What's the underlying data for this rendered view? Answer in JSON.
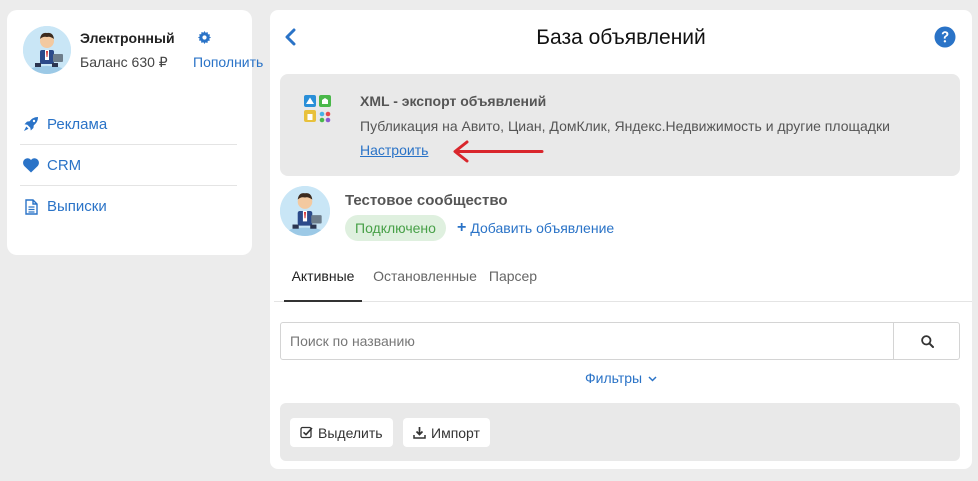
{
  "user": {
    "name": "Электронный",
    "balance": "Баланс 630 ₽",
    "topup_label": "Пополнить"
  },
  "nav": {
    "items": [
      {
        "label": "Реклама",
        "icon": "rocket-icon"
      },
      {
        "label": "CRM",
        "icon": "heart-icon"
      },
      {
        "label": "Выписки",
        "icon": "document-icon"
      }
    ]
  },
  "header": {
    "title": "База объявлений"
  },
  "xml_export": {
    "title": "XML - экспорт объявлений",
    "description": "Публикация на Авито, Циан, ДомКлик, Яндекс.Недвижимость и другие площадки",
    "configure_label": "Настроить"
  },
  "community": {
    "name": "Тестовое сообщество",
    "status": "Подключено",
    "add_label": "Добавить объявление"
  },
  "tabs": [
    {
      "label": "Активные",
      "active": true
    },
    {
      "label": "Остановленные",
      "active": false
    },
    {
      "label": "Парсер",
      "active": false
    }
  ],
  "search": {
    "placeholder": "Поиск по названию",
    "value": ""
  },
  "filters_label": "Фильтры",
  "bulk": {
    "select_label": "Выделить",
    "import_label": "Импорт"
  },
  "colors": {
    "accent": "#2a73c7",
    "status_green": "#47a047",
    "annotation_red": "#d9262c"
  }
}
